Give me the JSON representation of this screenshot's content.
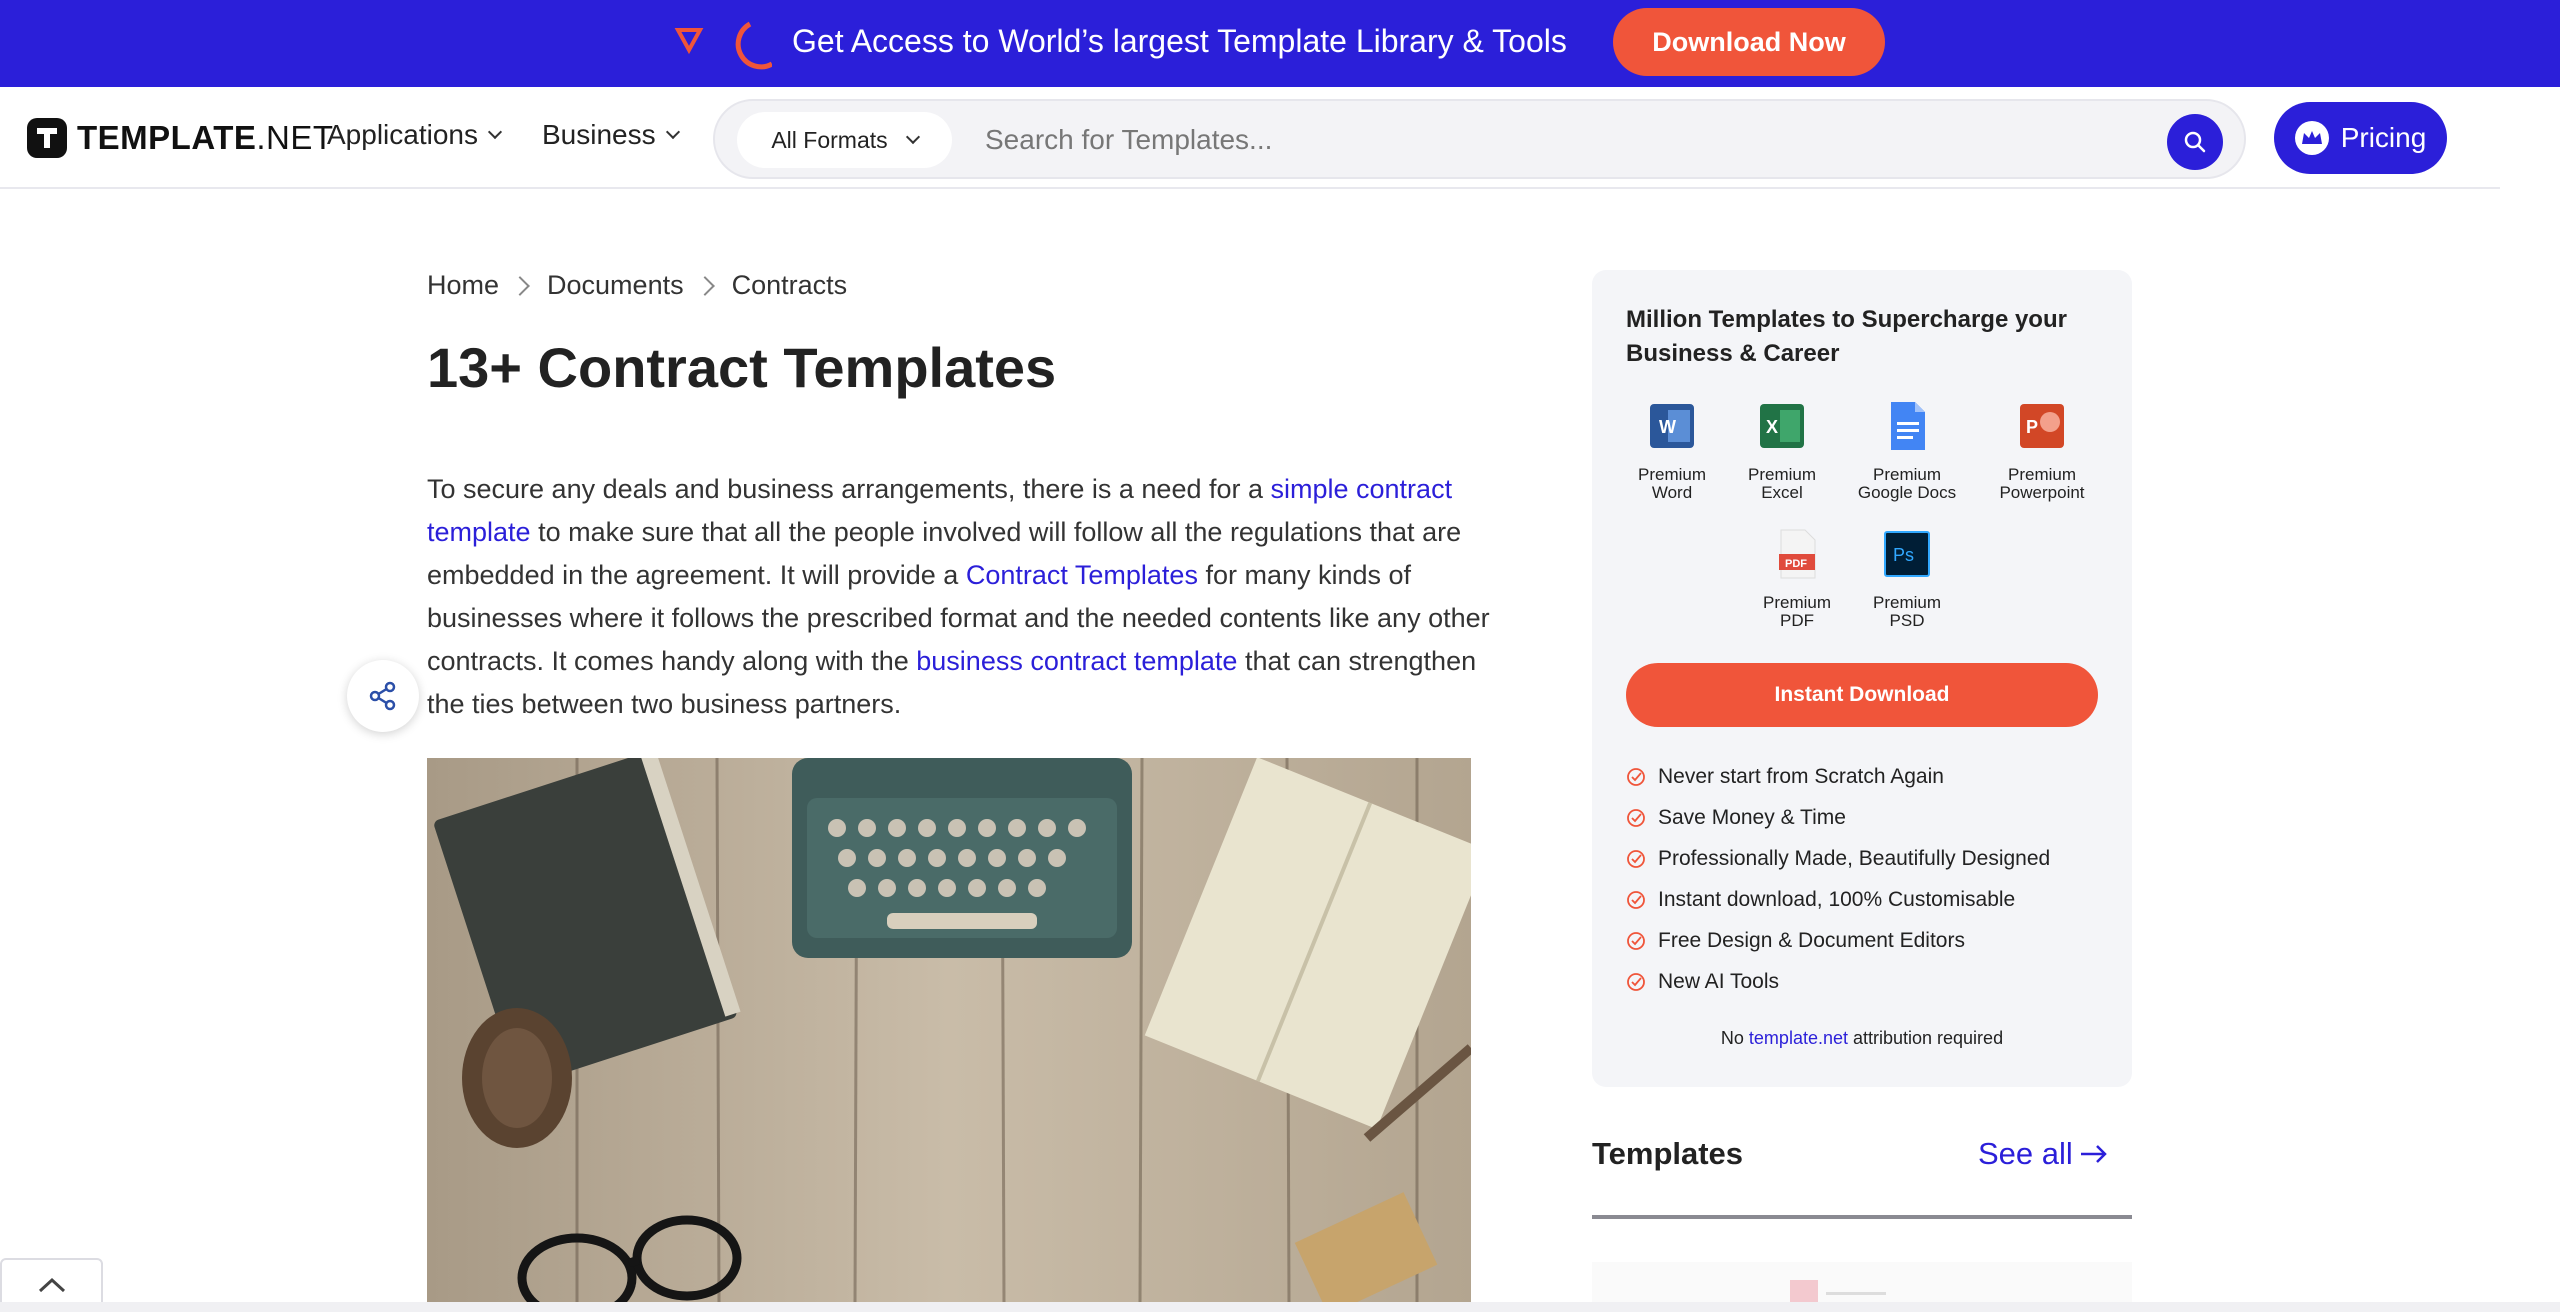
{
  "promo": {
    "text": "Get Access to World’s largest Template Library & Tools",
    "button": "Download Now"
  },
  "header": {
    "brand_bold": "TEMPLATE",
    "brand_thin": ".NET",
    "nav": [
      "Applications",
      "Business"
    ],
    "format_select": "All Formats",
    "search_placeholder": "Search for Templates...",
    "pricing": "Pricing"
  },
  "breadcrumb": [
    "Home",
    "Documents",
    "Contracts"
  ],
  "page": {
    "title": "13+ Contract Templates",
    "intro": {
      "t1": "To secure any deals and business arrangements, there is a need for a ",
      "l1": "simple contract template",
      "t2": " to make sure that all the people involved will follow all the regulations that are embedded in the agreement. It will provide a ",
      "l2": "Contract Templates",
      "t3": " for many kinds of businesses where it follows the prescribed format and the needed contents like any other contracts. It comes handy along with the ",
      "l3": "business contract template",
      "t4": " that can strengthen the ties between two business partners."
    }
  },
  "side_card": {
    "title": "Million Templates to Supercharge your Business & Career",
    "apps": [
      {
        "line1": "Premium",
        "line2": "Word",
        "icon": "word-icon",
        "color": "#2b579a"
      },
      {
        "line1": "Premium",
        "line2": "Excel",
        "icon": "excel-icon",
        "color": "#217346"
      },
      {
        "line1": "Premium",
        "line2": "Google Docs",
        "icon": "google-docs-icon",
        "color": "#4285f4"
      },
      {
        "line1": "Premium",
        "line2": "Powerpoint",
        "icon": "powerpoint-icon",
        "color": "#d24726"
      },
      {
        "line1": "Premium",
        "line2": "PDF",
        "icon": "pdf-icon",
        "color": "#e04b3c"
      },
      {
        "line1": "Premium",
        "line2": "PSD",
        "icon": "photoshop-icon",
        "color": "#31a8ff"
      }
    ],
    "button": "Instant Download",
    "features": [
      "Never start from Scratch Again",
      "Save Money & Time",
      "Professionally Made, Beautifully Designed",
      "Instant download, 100% Customisable",
      "Free Design & Document Editors",
      "New AI Tools"
    ],
    "attribution": {
      "pre": "No ",
      "link": "template.net",
      "post": " attribution required"
    }
  },
  "templates": {
    "heading": "Templates",
    "see_all": "See all"
  },
  "colors": {
    "brand_blue": "#2b1fd9",
    "accent_orange": "#f0553a"
  }
}
